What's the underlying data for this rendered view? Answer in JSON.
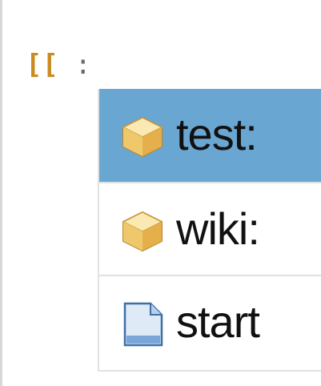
{
  "editor": {
    "typed": {
      "brackets": "[[",
      "colon": ":"
    }
  },
  "autocomplete": {
    "items": [
      {
        "label": "test:",
        "icon": "namespace-box-icon",
        "selected": true
      },
      {
        "label": "wiki:",
        "icon": "namespace-box-icon",
        "selected": false
      },
      {
        "label": "start",
        "icon": "page-document-icon",
        "selected": false
      }
    ]
  },
  "colors": {
    "selection": "#6aa6d2",
    "bracket": "#c98b1e"
  }
}
